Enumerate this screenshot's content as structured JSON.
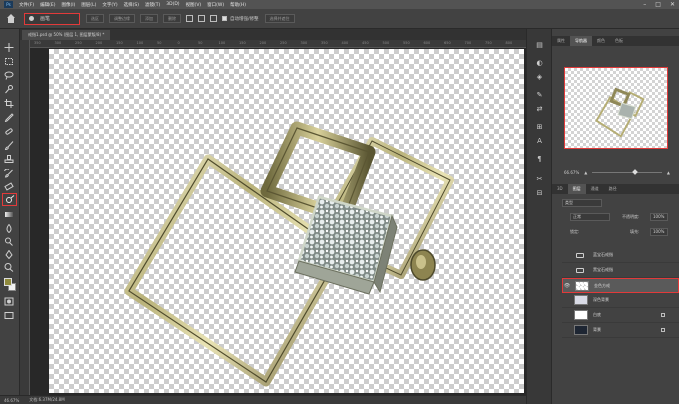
{
  "menubar": {
    "logo": "Ps",
    "items": [
      "文件(F)",
      "编辑(E)",
      "图像(I)",
      "图层(L)",
      "文字(Y)",
      "选择(S)",
      "滤镜(T)",
      "3D(D)",
      "视图(V)",
      "窗口(W)",
      "帮助(H)"
    ],
    "window_controls": [
      "–",
      "□",
      "✕"
    ]
  },
  "options": {
    "preset_label": "画笔",
    "buttons": [
      "选区",
      "调整边缘",
      "添加",
      "删除"
    ],
    "auto_enhance_label": "自动增强/修整",
    "refine_button": "选择并遮住"
  },
  "document": {
    "tab_title": "戒指1.psd @ 50% (图层 1, 图层蒙版/8) *"
  },
  "ruler_marks": [
    "350",
    "300",
    "250",
    "200",
    "150",
    "100",
    "50",
    "0",
    "50",
    "100",
    "150",
    "200",
    "250",
    "300",
    "350",
    "400",
    "450",
    "500",
    "550",
    "600",
    "650",
    "700",
    "750",
    "800"
  ],
  "status": {
    "zoom": "46.67%",
    "doc_info": "文档:6.37M/24.8M"
  },
  "panels": {
    "top_tabs": [
      "属性",
      "导航器",
      "颜色",
      "色板"
    ],
    "active_top_tab": "导航器",
    "zoom_value": "66.67%",
    "layer_tabs": [
      "3D",
      "图层",
      "通道",
      "路径"
    ],
    "active_layer_tab": "图层",
    "kind_label": "类型",
    "blend_mode": "正常",
    "opacity_label": "不透明度:",
    "opacity_value": "100%",
    "lock_label": "锁定:",
    "fill_label": "填充:",
    "fill_value": "100%"
  },
  "layers": [
    {
      "name": "蓝宝石戒指",
      "type": "group",
      "visible": false,
      "selected": false,
      "locked": false
    },
    {
      "name": "黑宝石戒指",
      "type": "group",
      "visible": false,
      "selected": false,
      "locked": false
    },
    {
      "name": "金色方戒",
      "type": "layer",
      "visible": true,
      "selected": true,
      "locked": false
    },
    {
      "name": "深色背景",
      "type": "layer",
      "visible": false,
      "selected": false,
      "locked": false
    },
    {
      "name": "白底",
      "type": "layer",
      "visible": false,
      "selected": false,
      "locked": true
    },
    {
      "name": "背景",
      "type": "layer",
      "visible": false,
      "selected": false,
      "locked": true
    }
  ],
  "colors": {
    "accent_red": "#e23a3a",
    "foreground_swatch": "#8f8a3c",
    "background_swatch": "#f2f2f2"
  }
}
